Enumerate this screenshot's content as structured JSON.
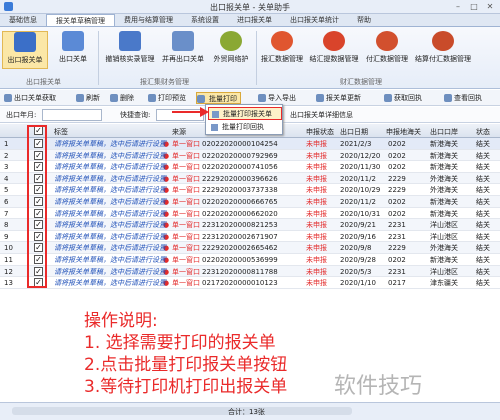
{
  "window": {
    "title": "出口报关单 - 关单助手"
  },
  "menu_tabs": [
    "基础信息",
    "报关单草稿管理",
    "费用与结算管理",
    "系统设置",
    "进口报关单",
    "出口报关单统计",
    "帮助"
  ],
  "ribbon": {
    "buttons": [
      {
        "label": "出口报关单",
        "color": "#3b6fc8"
      },
      {
        "label": "出口关单",
        "color": "#5b8ad6"
      },
      {
        "label": "撤销核实录管理",
        "color": "#4a79c9"
      },
      {
        "label": "并再出口关单",
        "color": "#6a8fc9"
      },
      {
        "label": "外贸网络护",
        "color": "#8aa833"
      },
      {
        "label": "报汇数据管理",
        "color": "#e0562f"
      },
      {
        "label": "结汇提数据管理",
        "color": "#d9442b"
      },
      {
        "label": "付汇数据管理",
        "color": "#d2502e"
      },
      {
        "label": "结算付汇数据管理",
        "color": "#c94b2a"
      }
    ],
    "groups": [
      "出口报关单",
      "报汇集财务管理",
      "财汇数据管理"
    ]
  },
  "toolbar": {
    "buttons": [
      "出口关单获取",
      "刷新",
      "删除",
      "打印预览",
      "批量打印",
      "导入导出",
      "报关单更新",
      "获取回执",
      "查看回执"
    ]
  },
  "filter": {
    "month_label": "出口年月:",
    "quick_label": "快捷查询:",
    "detail_label": "出口报关单详细信息"
  },
  "dropdown": {
    "items": [
      "批量打印报关单",
      "批量打印回执"
    ]
  },
  "grid": {
    "headers": [
      "标签",
      "来源",
      "统一编号",
      "申报状态",
      "出口日期",
      "申报地海关",
      "出口口岸",
      "状态"
    ],
    "rows": [
      {
        "n": "1",
        "tag": "请将报关单草稿，选中后请进行设置",
        "src": "单一窗口",
        "id": "02022020000104254",
        "state": "未申报",
        "date": "2021/2/3",
        "code": "0202",
        "port": "新港海关",
        "status": "结关"
      },
      {
        "n": "2",
        "tag": "请将报关单草稿，选中后请进行设置",
        "src": "单一窗口",
        "id": "02202020000792969",
        "state": "未申报",
        "date": "2020/12/20",
        "code": "0202",
        "port": "新港海关",
        "status": "结关"
      },
      {
        "n": "3",
        "tag": "请将报关单草稿，选中后请进行设置",
        "src": "单一窗口",
        "id": "02202020000741056",
        "state": "未申报",
        "date": "2020/11/30",
        "code": "0202",
        "port": "新港海关",
        "status": "结关"
      },
      {
        "n": "4",
        "tag": "请将报关单草稿，选中后请进行设置",
        "src": "单一窗口",
        "id": "22292020000396626",
        "state": "未申报",
        "date": "2020/11/2",
        "code": "2229",
        "port": "外港海关",
        "status": "结关"
      },
      {
        "n": "5",
        "tag": "请将报关单草稿，选中后请进行设置",
        "src": "单一窗口",
        "id": "22292020003737338",
        "state": "未申报",
        "date": "2020/10/29",
        "code": "2229",
        "port": "外港海关",
        "status": "结关"
      },
      {
        "n": "6",
        "tag": "请将报关单草稿，选中后请进行设置",
        "src": "单一窗口",
        "id": "02202020000666765",
        "state": "未申报",
        "date": "2020/11/2",
        "code": "0202",
        "port": "新港海关",
        "status": "结关"
      },
      {
        "n": "7",
        "tag": "请将报关单草稿，选中后请进行设置",
        "src": "单一窗口",
        "id": "02202020000662020",
        "state": "未申报",
        "date": "2020/10/31",
        "code": "0202",
        "port": "新港海关",
        "status": "结关"
      },
      {
        "n": "8",
        "tag": "请将报关单草稿，选中后请进行设置",
        "src": "单一窗口",
        "id": "22312020000821253",
        "state": "未申报",
        "date": "2020/9/21",
        "code": "2231",
        "port": "洋山港区",
        "status": "结关"
      },
      {
        "n": "9",
        "tag": "请将报关单草稿，选中后请进行设置",
        "src": "单一窗口",
        "id": "22312020002671907",
        "state": "未申报",
        "date": "2020/9/16",
        "code": "2231",
        "port": "洋山港区",
        "status": "结关"
      },
      {
        "n": "10",
        "tag": "请将报关单草稿，选中后请进行设置",
        "src": "单一窗口",
        "id": "22292020002665462",
        "state": "未申报",
        "date": "2020/9/8",
        "code": "2229",
        "port": "外港海关",
        "status": "结关"
      },
      {
        "n": "11",
        "tag": "请将报关单草稿，选中后请进行设置",
        "src": "单一窗口",
        "id": "02202020000536999",
        "state": "未申报",
        "date": "2020/9/28",
        "code": "0202",
        "port": "新港海关",
        "status": "结关"
      },
      {
        "n": "12",
        "tag": "请将报关单草稿，选中后请进行设置",
        "src": "单一窗口",
        "id": "22312020000811788",
        "state": "未申报",
        "date": "2020/5/3",
        "code": "2231",
        "port": "洋山港区",
        "status": "结关"
      },
      {
        "n": "13",
        "tag": "请将报关单草稿，选中后请进行设置",
        "src": "单一窗口",
        "id": "02172020000010123",
        "state": "未申报",
        "date": "2020/1/10",
        "code": "0217",
        "port": "津东疆关",
        "status": "结关"
      }
    ]
  },
  "instructions": {
    "title": "操作说明:",
    "step1": "1. 选择需要打印的报关单",
    "step2": "2.点击批量打印报关单按钮",
    "step3": "3.等待打印机打印出报关单"
  },
  "watermark": "软件技巧",
  "status": {
    "total": "合计：13张"
  },
  "colors": {
    "accent": "#ea2a2a",
    "header_bg": "#dbe3ef",
    "highlight": "#fbe7a7"
  }
}
